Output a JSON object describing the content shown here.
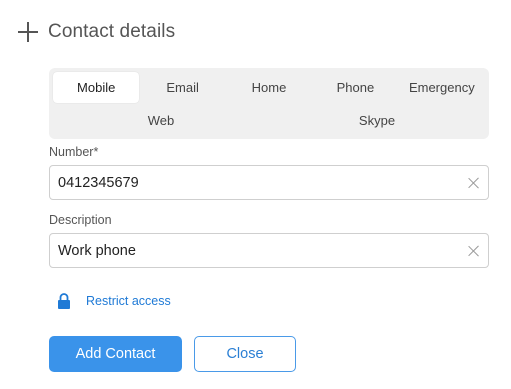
{
  "header": {
    "title": "Contact details"
  },
  "tabs": {
    "row1": [
      {
        "label": "Mobile",
        "active": true
      },
      {
        "label": "Email",
        "active": false
      },
      {
        "label": "Home",
        "active": false
      },
      {
        "label": "Phone",
        "active": false
      },
      {
        "label": "Emergency",
        "active": false
      }
    ],
    "row2": [
      {
        "label": "Web",
        "active": false
      },
      {
        "label": "Skype",
        "active": false
      }
    ]
  },
  "number": {
    "label": "Number*",
    "value": "0412345679"
  },
  "description": {
    "label": "Description",
    "value": "Work phone"
  },
  "restrict": {
    "label": "Restrict access",
    "icon": "lock-icon"
  },
  "buttons": {
    "add_label": "Add Contact",
    "close_label": "Close"
  },
  "colors": {
    "accent": "#3a93ea",
    "link": "#1f7ad6",
    "tab_bg": "#f0f0f0"
  }
}
